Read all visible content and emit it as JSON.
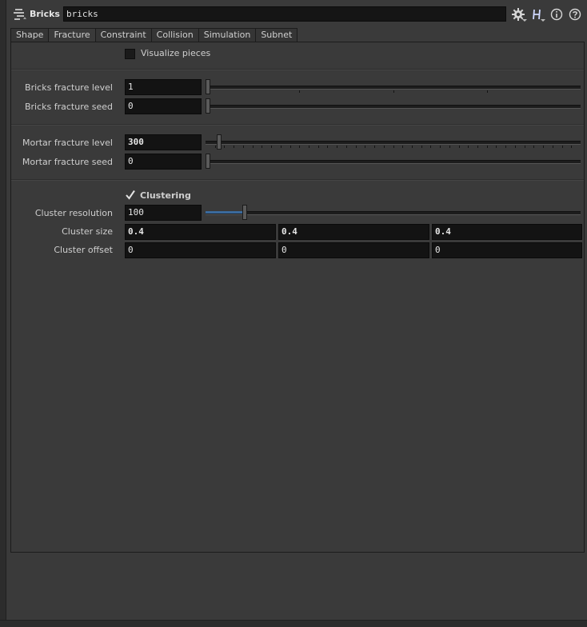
{
  "header": {
    "node_type": "Bricks",
    "node_name": "bricks",
    "icons": [
      "node-type-icon",
      "gear-icon",
      "houdini-h-icon",
      "info-icon",
      "help-icon"
    ]
  },
  "tabs": [
    {
      "label": "Shape",
      "active": false
    },
    {
      "label": "Fracture",
      "active": true
    },
    {
      "label": "Constraint",
      "active": false
    },
    {
      "label": "Collision",
      "active": false
    },
    {
      "label": "Simulation",
      "active": false
    },
    {
      "label": "Subnet",
      "active": false
    }
  ],
  "fracture": {
    "visualize_pieces": {
      "label": "Visualize pieces",
      "checked": false
    },
    "bricks_fracture_level": {
      "label": "Bricks fracture level",
      "value": "1",
      "fraction": 0.0
    },
    "bricks_fracture_seed": {
      "label": "Bricks fracture seed",
      "value": "0",
      "fraction": 0.0
    },
    "mortar_fracture_level": {
      "label": "Mortar fracture level",
      "value": "300",
      "fraction": 0.03
    },
    "mortar_fracture_seed": {
      "label": "Mortar fracture seed",
      "value": "0",
      "fraction": 0.0
    },
    "clustering": {
      "label": "Clustering",
      "checked": true
    },
    "cluster_resolution": {
      "label": "Cluster resolution",
      "value": "100",
      "fraction": 0.1
    },
    "cluster_size": {
      "label": "Cluster size",
      "values": [
        "0.4",
        "0.4",
        "0.4"
      ]
    },
    "cluster_offset": {
      "label": "Cluster offset",
      "values": [
        "0",
        "0",
        "0"
      ]
    }
  },
  "colors": {
    "accent": "#3a6a9c",
    "background": "#3a3a3a",
    "field": "#131313"
  }
}
